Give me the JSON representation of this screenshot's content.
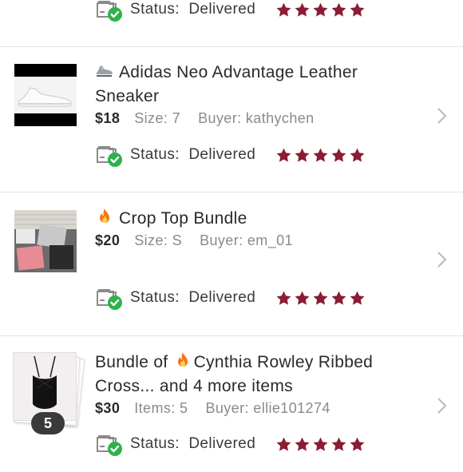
{
  "orders": [
    {
      "status_label": "Status:",
      "status_value": "Delivered",
      "rating": 5
    },
    {
      "emoji": "sneaker-icon",
      "title_line1": "Adidas Neo Advantage Leather",
      "title_line2": "Sneaker",
      "price": "$18",
      "detail": "Size: 7",
      "buyer": "Buyer: kathychen",
      "status_label": "Status:",
      "status_value": "Delivered",
      "rating": 5
    },
    {
      "emoji": "fire-icon",
      "title_line1": "Crop Top Bundle",
      "price": "$20",
      "detail": "Size: S",
      "buyer": "Buyer: em_01",
      "status_label": "Status:",
      "status_value": "Delivered",
      "rating": 5
    },
    {
      "emoji": "fire-icon",
      "title_prefix": "Bundle of ",
      "title_line1": "Cynthia Rowley Ribbed",
      "title_line2": "Cross... and 4 more items",
      "price": "$30",
      "detail": "Items: 5",
      "buyer": "Buyer: ellie101274",
      "bundle_count": "5",
      "status_label": "Status:",
      "status_value": "Delivered",
      "rating": 5
    }
  ],
  "colors": {
    "star": "#8a1c35",
    "check": "#2eb24a",
    "badge": "#3a3a3a",
    "chevron": "#b8b8b8"
  }
}
